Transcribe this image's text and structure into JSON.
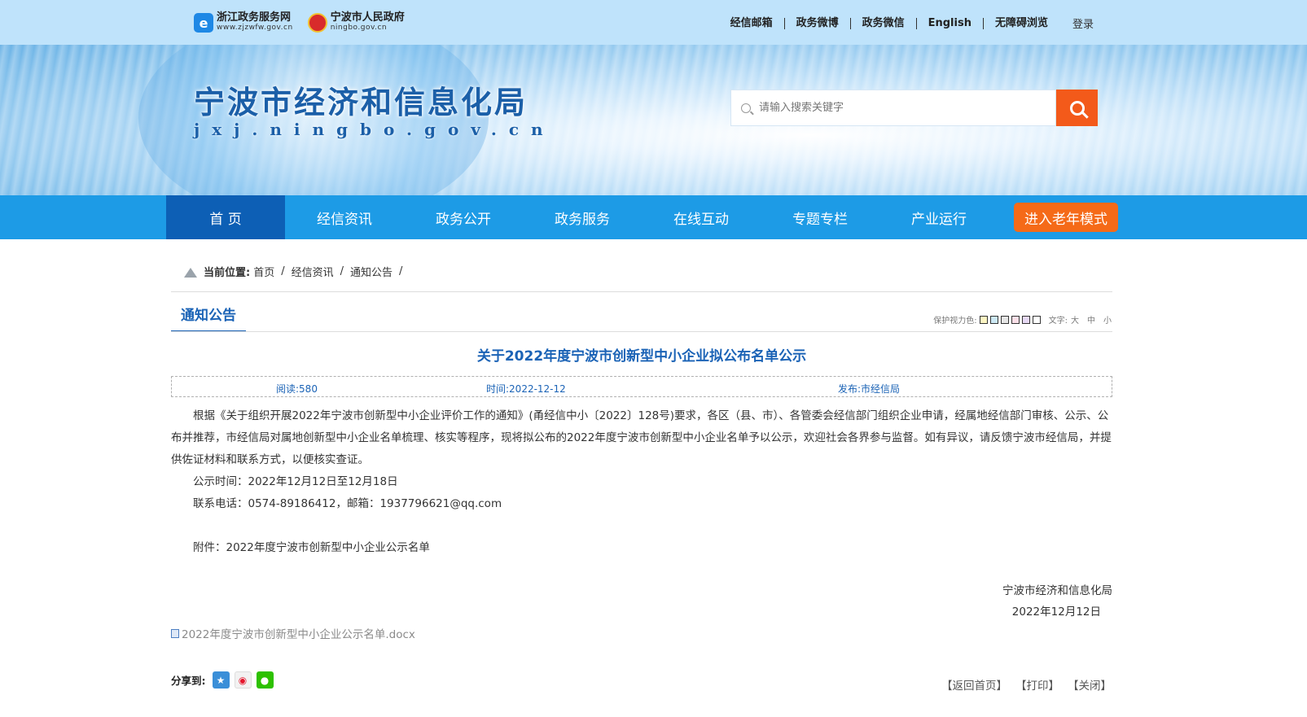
{
  "topbar": {
    "logo1": {
      "name": "浙江政务服务网",
      "domain": "www.zjzwfw.gov.cn"
    },
    "logo2": {
      "name": "宁波市人民政府",
      "domain": "ningbo.gov.cn"
    },
    "links": [
      "经信邮箱",
      "政务微博",
      "政务微信",
      "English",
      "无障碍浏览"
    ],
    "login": "登录"
  },
  "banner": {
    "title": "宁波市经济和信息化局",
    "domain": "jxj.ningbo.gov.cn",
    "search_placeholder": "请输入搜索关键字"
  },
  "nav": {
    "items": [
      "首 页",
      "经信资讯",
      "政务公开",
      "政务服务",
      "在线互动",
      "专题专栏",
      "产业运行"
    ],
    "elder_mode": "进入老年模式"
  },
  "breadcrumb": {
    "label": "当前位置:",
    "items": [
      "首页",
      "经信资讯",
      "通知公告"
    ],
    "sep": "/"
  },
  "section": {
    "title": "通知公告",
    "protect_label": "保护视力色:",
    "protect_colors": [
      "#fdf6c3",
      "#cce8f4",
      "#e6e6e6",
      "#fbdfe8",
      "#e7d9f5",
      "#ffffff"
    ],
    "font_label": "文字:",
    "font_sizes": [
      "大",
      "中",
      "小"
    ]
  },
  "article": {
    "title": "关于2022年度宁波市创新型中小企业拟公布名单公示",
    "reads": "阅读:580",
    "time": "时间:2022-12-12",
    "publisher": "发布:市经信局",
    "para1": "根据《关于组织开展2022年宁波市创新型中小企业评价工作的通知》(甬经信中小〔2022〕128号)要求，各区（县、市）、各管委会经信部门组织企业申请，经属地经信部门审核、公示、公布并推荐，市经信局对属地创新型中小企业名单梳理、核实等程序，现将拟公布的2022年度宁波市创新型中小企业名单予以公示，欢迎社会各界参与监督。如有异议，请反馈宁波市经信局，并提供佐证材料和联系方式，以便核实查证。",
    "period": "公示时间：2022年12月12日至12月18日",
    "contact": "联系电话：0574-89186412，邮箱：1937796621@qq.com",
    "attachment_line": "附件：2022年度宁波市创新型中小企业公示名单",
    "signer": "宁波市经济和信息化局",
    "sign_date": "2022年12月12日",
    "file": "2022年度宁波市创新型中小企业公示名单.docx"
  },
  "footer": {
    "share_label": "分享到:",
    "share_icons": [
      "qzone-icon",
      "weibo-icon",
      "wechat-icon"
    ],
    "actions": [
      "【返回首页】",
      "【打印】",
      "【关闭】"
    ]
  },
  "colors": {
    "accent": "#1b63b6",
    "nav": "#1d9be6",
    "nav_active": "#0d5fb5",
    "orange": "#f56a18"
  }
}
